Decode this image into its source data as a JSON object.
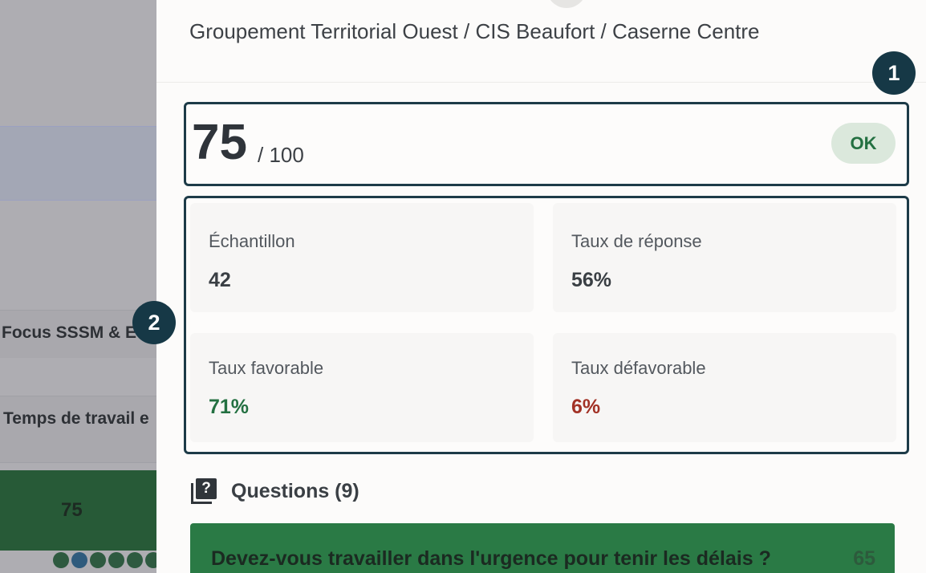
{
  "background": {
    "row1_label": "Focus SSSM & E",
    "row2_label": "Temps de travail e",
    "score_cell": "75",
    "colors": {
      "score_cell": "#275a37",
      "dot": "#2e5a40",
      "dot_blue": "#2f5b7d"
    }
  },
  "drawer": {
    "breadcrumb": "Groupement Territorial Ouest / CIS Beaufort / Caserne Centre",
    "score": {
      "value": "75",
      "max": "/ 100",
      "status": "OK"
    },
    "stats": [
      {
        "label": "Échantillon",
        "value": "42",
        "color": "#3a3f44"
      },
      {
        "label": "Taux de réponse",
        "value": "56%",
        "color": "#3a3f44"
      },
      {
        "label": "Taux favorable",
        "value": "71%",
        "color": "#237041"
      },
      {
        "label": "Taux défavorable",
        "value": "6%",
        "color": "#a23226"
      }
    ],
    "questions": {
      "title": "Questions (9)",
      "items": [
        {
          "text": "Devez-vous travailler dans l'urgence pour tenir les délais ?",
          "score": "65"
        }
      ]
    }
  },
  "markers": [
    "1",
    "2"
  ],
  "colors": {
    "accent_border": "#1d3b48",
    "marker": "#163846",
    "ok_badge_bg": "#dbe8dc",
    "ok_badge_text": "#237041",
    "question_card": "#2a7a45"
  }
}
